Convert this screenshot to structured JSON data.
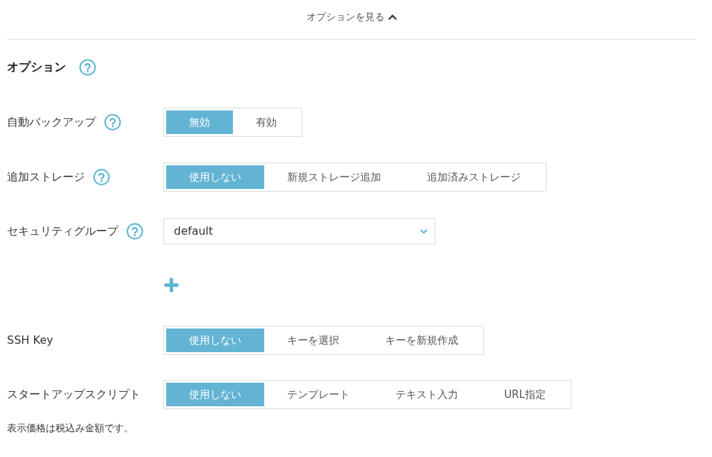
{
  "options_toggle": {
    "label": "オプションを見る",
    "expanded": true
  },
  "section": {
    "title": "オプション",
    "help": true
  },
  "fields": [
    {
      "kind": "segmented",
      "label": "自動バックアップ",
      "help": true,
      "options": [
        {
          "label": "無効",
          "selected": true
        },
        {
          "label": "有効",
          "selected": false
        }
      ]
    },
    {
      "kind": "segmented",
      "label": "追加ストレージ",
      "help": true,
      "options": [
        {
          "label": "使用しない",
          "selected": true
        },
        {
          "label": "新規ストレージ追加",
          "selected": false
        },
        {
          "label": "追加済みストレージ",
          "selected": false
        }
      ]
    },
    {
      "kind": "select",
      "label": "セキュリティグループ",
      "help": true,
      "value": "default"
    },
    {
      "kind": "add"
    },
    {
      "kind": "segmented",
      "label": "SSH Key",
      "help": false,
      "options": [
        {
          "label": "使用しない",
          "selected": true
        },
        {
          "label": "キーを選択",
          "selected": false
        },
        {
          "label": "キーを新規作成",
          "selected": false
        }
      ]
    },
    {
      "kind": "segmented",
      "label": "スタートアップスクリプト",
      "help": false,
      "options": [
        {
          "label": "使用しない",
          "selected": true
        },
        {
          "label": "テンプレート",
          "selected": false
        },
        {
          "label": "テキスト入力",
          "selected": false
        },
        {
          "label": "URL指定",
          "selected": false
        }
      ]
    }
  ],
  "note": "表示価格は税込み金額です。"
}
